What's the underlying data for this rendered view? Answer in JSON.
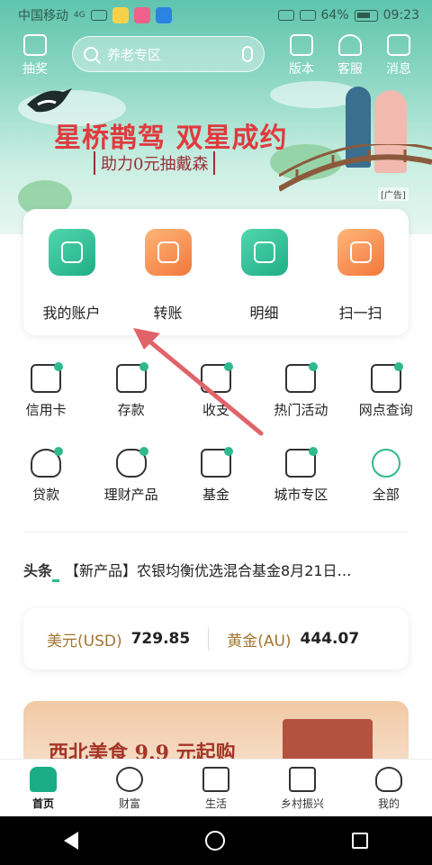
{
  "status_bar": {
    "carrier": "中国移动",
    "network": "4G",
    "battery": "64%",
    "time": "09:23"
  },
  "header": {
    "lottery_label": "抽奖",
    "search_placeholder": "养老专区",
    "version_label": "版本",
    "service_label": "客服",
    "message_label": "消息"
  },
  "banner": {
    "title": "星桥鹊驾 双星成约",
    "subtitle": "助力0元抽戴森",
    "ad_tag": "[广告]"
  },
  "quick_actions": [
    {
      "label": "我的账户",
      "icon": "account-icon",
      "color": "green"
    },
    {
      "label": "转账",
      "icon": "transfer-icon",
      "color": "orange"
    },
    {
      "label": "明细",
      "icon": "details-icon",
      "color": "green"
    },
    {
      "label": "扫一扫",
      "icon": "scan-icon",
      "color": "orange"
    }
  ],
  "services": {
    "row1": [
      {
        "label": "信用卡",
        "icon": "credit-card-icon"
      },
      {
        "label": "存款",
        "icon": "deposit-icon"
      },
      {
        "label": "收支",
        "icon": "income-expense-icon"
      },
      {
        "label": "热门活动",
        "icon": "megaphone-icon"
      },
      {
        "label": "网点查询",
        "icon": "bank-branch-icon"
      }
    ],
    "row2": [
      {
        "label": "贷款",
        "icon": "loan-bag-icon"
      },
      {
        "label": "理财产品",
        "icon": "coins-stack-icon"
      },
      {
        "label": "基金",
        "icon": "fund-chart-icon"
      },
      {
        "label": "城市专区",
        "icon": "city-buildings-icon"
      },
      {
        "label": "全部",
        "icon": "more-dots-icon"
      }
    ]
  },
  "news": {
    "label": "头条",
    "text": "【新产品】农银均衡优选混合基金8月21日…"
  },
  "rates": {
    "usd_label": "美元(USD)",
    "usd_value": "729.85",
    "gold_label": "黄金(AU)",
    "gold_value": "444.07"
  },
  "promo": {
    "text": "西北美食 9.9 元起购"
  },
  "tabbar": [
    {
      "label": "首页",
      "icon": "home-icon",
      "active": true
    },
    {
      "label": "财富",
      "icon": "yuan-coin-icon",
      "active": false
    },
    {
      "label": "生活",
      "icon": "shopping-bag-icon",
      "active": false
    },
    {
      "label": "乡村振兴",
      "icon": "book-icon",
      "active": false
    },
    {
      "label": "我的",
      "icon": "user-icon",
      "active": false
    }
  ],
  "colors": {
    "primary": "#1aad86",
    "banner_title": "#e03a3e",
    "rate_label": "#a2742f",
    "arrow": "#e0636a"
  }
}
